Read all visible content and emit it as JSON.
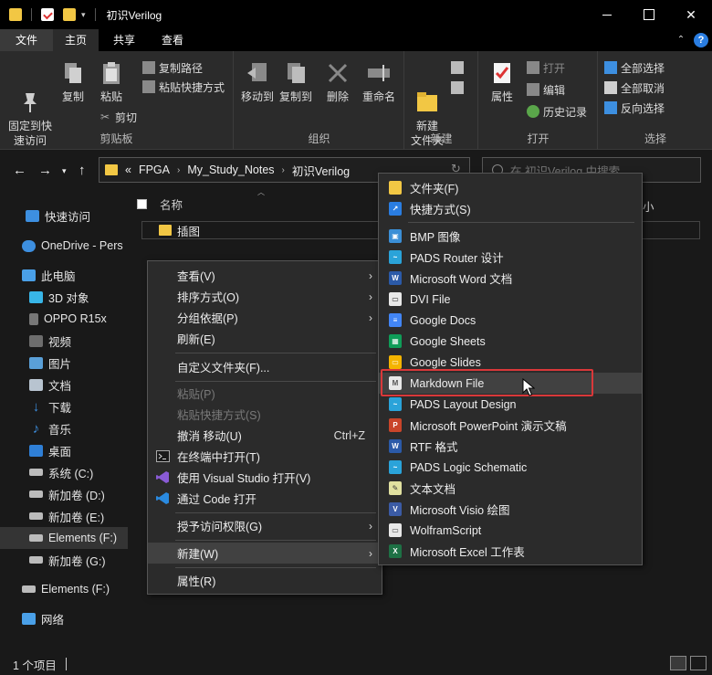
{
  "window": {
    "title": "初识Verilog",
    "min_glyph": "",
    "max_glyph": "",
    "close_glyph": "✕"
  },
  "ribbon_tabs": {
    "file": "文件",
    "home": "主页",
    "share": "共享",
    "view": "查看",
    "help": "?"
  },
  "ribbon": {
    "clipboard": {
      "label": "剪贴板",
      "pin": "固定到快\n速访问",
      "copy": "复制",
      "paste": "粘贴",
      "copy_path": "复制路径",
      "paste_shortcut": "粘贴快捷方式",
      "cut": "剪切"
    },
    "organize": {
      "label": "组织",
      "move_to": "移动到",
      "copy_to": "复制到",
      "delete": "删除",
      "rename": "重命名"
    },
    "new": {
      "label": "新建",
      "new_folder": "新建\n文件夹"
    },
    "open": {
      "label": "打开",
      "properties": "属性",
      "open": "打开",
      "edit": "编辑",
      "history": "历史记录"
    },
    "select": {
      "label": "选择",
      "select_all": "全部选择",
      "select_none": "全部取消",
      "invert": "反向选择"
    }
  },
  "address": {
    "crumbs": [
      "«",
      "FPGA",
      "My_Study_Notes",
      "初识Verilog"
    ],
    "search_placeholder": "在 初识Verilog 中搜索"
  },
  "nav": {
    "items": [
      {
        "label": "快速访问",
        "icon": "star-icon",
        "color": "#3d8fe0"
      },
      {
        "label": "OneDrive - Pers",
        "icon": "cloud-icon",
        "color": "#3d8fe0"
      },
      {
        "label": "此电脑",
        "icon": "computer-icon",
        "color": "#4aa0e8"
      },
      {
        "label": "3D 对象",
        "icon": "cube-icon",
        "color": "#38b6e8"
      },
      {
        "label": "OPPO R15x",
        "icon": "phone-icon",
        "color": "#777777"
      },
      {
        "label": "视频",
        "icon": "video-icon",
        "color": "#6d6d6d"
      },
      {
        "label": "图片",
        "icon": "picture-icon",
        "color": "#5aa0d8"
      },
      {
        "label": "文档",
        "icon": "document-icon",
        "color": "#b8c4d0"
      },
      {
        "label": "下载",
        "icon": "download-icon",
        "color": "#3d8fe0"
      },
      {
        "label": "音乐",
        "icon": "music-icon",
        "color": "#3d8fe0"
      },
      {
        "label": "桌面",
        "icon": "desktop-icon",
        "color": "#2f7fd6"
      },
      {
        "label": "系统 (C:)",
        "icon": "drive-icon",
        "color": "#bbbbbb"
      },
      {
        "label": "新加卷 (D:)",
        "icon": "drive-icon",
        "color": "#bbbbbb"
      },
      {
        "label": "新加卷 (E:)",
        "icon": "drive-icon",
        "color": "#bbbbbb"
      },
      {
        "label": "Elements (F:)",
        "icon": "drive-icon",
        "color": "#bbbbbb"
      },
      {
        "label": "新加卷 (G:)",
        "icon": "drive-icon",
        "color": "#bbbbbb"
      },
      {
        "label": "Elements (F:)",
        "icon": "drive-icon",
        "color": "#bbbbbb"
      },
      {
        "label": "网络",
        "icon": "network-icon",
        "color": "#4aa0e8"
      }
    ]
  },
  "content": {
    "column_name": "名称",
    "column_size_cut": "小",
    "file_name": "插图"
  },
  "context_menu": {
    "view": "查看(V)",
    "sort": "排序方式(O)",
    "group": "分组依据(P)",
    "refresh": "刷新(E)",
    "customize": "自定义文件夹(F)...",
    "paste": "粘贴(P)",
    "paste_shortcut": "粘贴快捷方式(S)",
    "undo": "撤消 移动(U)",
    "undo_shortcut": "Ctrl+Z",
    "terminal": "在终端中打开(T)",
    "vs": "使用 Visual Studio 打开(V)",
    "code": "通过 Code 打开",
    "grant": "授予访问权限(G)",
    "new": "新建(W)",
    "properties": "属性(R)"
  },
  "submenu": {
    "items": [
      {
        "label": "文件夹(F)",
        "icon": "folder-icon",
        "color": "#f2c744",
        "glyph": ""
      },
      {
        "label": "快捷方式(S)",
        "icon": "shortcut-icon",
        "color": "#2a7de1",
        "glyph": "↗"
      },
      {
        "label": "BMP 图像",
        "icon": "bmp-icon",
        "color": "#3b8fd6",
        "glyph": "▣"
      },
      {
        "label": "PADS Router 设计",
        "icon": "pads-router-icon",
        "color": "#2aa3d9",
        "glyph": "~"
      },
      {
        "label": "Microsoft Word 文档",
        "icon": "word-icon",
        "color": "#2b5aa8",
        "glyph": "W"
      },
      {
        "label": "DVI File",
        "icon": "dvi-icon",
        "color": "#e8e8e8",
        "glyph": "▭"
      },
      {
        "label": "Google Docs",
        "icon": "google-docs-icon",
        "color": "#4285f4",
        "glyph": "≡"
      },
      {
        "label": "Google Sheets",
        "icon": "google-sheets-icon",
        "color": "#0f9d58",
        "glyph": "▦"
      },
      {
        "label": "Google Slides",
        "icon": "google-slides-icon",
        "color": "#f4b400",
        "glyph": "▭"
      },
      {
        "label": "Markdown File",
        "icon": "markdown-icon",
        "color": "#e8e8e8",
        "glyph": "M"
      },
      {
        "label": "PADS Layout Design",
        "icon": "pads-layout-icon",
        "color": "#2aa3d9",
        "glyph": "~"
      },
      {
        "label": "Microsoft PowerPoint 演示文稿",
        "icon": "powerpoint-icon",
        "color": "#c9452a",
        "glyph": "P"
      },
      {
        "label": "RTF 格式",
        "icon": "rtf-icon",
        "color": "#2b5aa8",
        "glyph": "W"
      },
      {
        "label": "PADS Logic Schematic",
        "icon": "pads-logic-icon",
        "color": "#2aa3d9",
        "glyph": "~"
      },
      {
        "label": "文本文档",
        "icon": "text-document-icon",
        "color": "#e0e0a0",
        "glyph": "✎"
      },
      {
        "label": "Microsoft Visio 绘图",
        "icon": "visio-icon",
        "color": "#3b5ba5",
        "glyph": "V"
      },
      {
        "label": "WolframScript",
        "icon": "wolfram-icon",
        "color": "#e8e8e8",
        "glyph": "▭"
      },
      {
        "label": "Microsoft Excel 工作表",
        "icon": "excel-icon",
        "color": "#1e7145",
        "glyph": "X"
      }
    ]
  },
  "status": {
    "count": "1 个项目"
  },
  "colors": {
    "accent": "#2a7de1",
    "highlight": "#d9383a",
    "folder": "#f2c744"
  }
}
